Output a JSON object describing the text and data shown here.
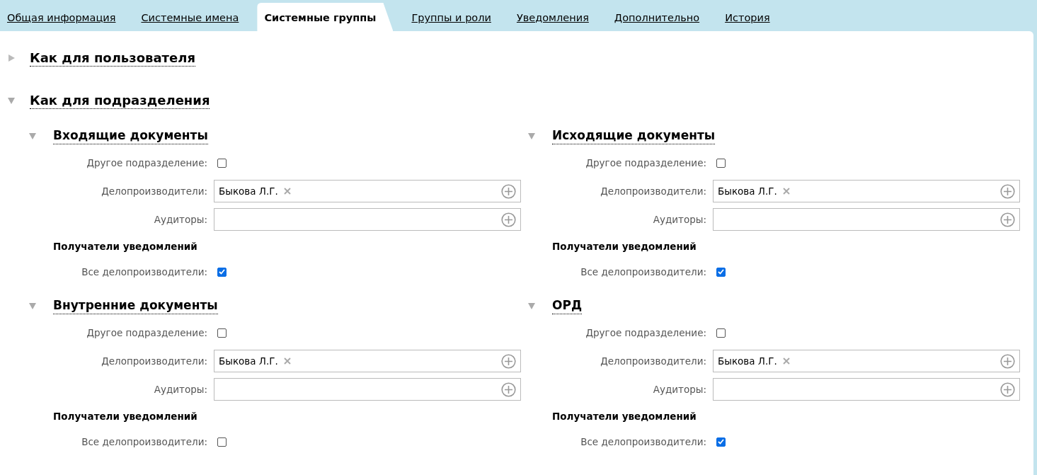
{
  "tabs": [
    {
      "label": "Общая информация",
      "selected": false
    },
    {
      "label": "Системные имена",
      "selected": false
    },
    {
      "label": "Системные группы",
      "selected": true
    },
    {
      "label": "Группы и роли",
      "selected": false
    },
    {
      "label": "Уведомления",
      "selected": false
    },
    {
      "label": "Дополнительно",
      "selected": false
    },
    {
      "label": "История",
      "selected": false
    }
  ],
  "sections": [
    {
      "title": "Как для пользователя",
      "expanded": false
    },
    {
      "title": "Как для подразделения",
      "expanded": true,
      "subsections": [
        {
          "title": "Входящие документы",
          "expanded": true,
          "fields": [
            {
              "kind": "checkbox",
              "label": "Другое подразделение:",
              "checked": false
            },
            {
              "kind": "picker",
              "label": "Делопроизводители:",
              "tags": [
                "Быкова Л.Г."
              ]
            },
            {
              "kind": "picker",
              "label": "Аудиторы:"
            },
            {
              "kind": "heading",
              "label": "Получатели уведомлений"
            },
            {
              "kind": "checkbox",
              "label": "Все делопроизводители:",
              "checked": true
            }
          ]
        },
        {
          "title": "Исходящие документы",
          "expanded": true,
          "fields": [
            {
              "kind": "checkbox",
              "label": "Другое подразделение:",
              "checked": false
            },
            {
              "kind": "picker",
              "label": "Делопроизводители:",
              "tags": [
                "Быкова Л.Г."
              ]
            },
            {
              "kind": "picker",
              "label": "Аудиторы:"
            },
            {
              "kind": "heading",
              "label": "Получатели уведомлений"
            },
            {
              "kind": "checkbox",
              "label": "Все делопроизводители:",
              "checked": true
            }
          ]
        },
        {
          "title": "Внутренние документы",
          "expanded": true,
          "fields": [
            {
              "kind": "checkbox",
              "label": "Другое подразделение:",
              "checked": false
            },
            {
              "kind": "picker",
              "label": "Делопроизводители:",
              "tags": [
                "Быкова Л.Г."
              ]
            },
            {
              "kind": "picker",
              "label": "Аудиторы:"
            },
            {
              "kind": "heading",
              "label": "Получатели уведомлений"
            },
            {
              "kind": "checkbox",
              "label": "Все делопроизводители:",
              "checked": false
            }
          ]
        },
        {
          "title": "ОРД",
          "expanded": true,
          "fields": [
            {
              "kind": "checkbox",
              "label": "Другое подразделение:",
              "checked": false
            },
            {
              "kind": "picker",
              "label": "Делопроизводители:",
              "tags": [
                "Быкова Л.Г."
              ]
            },
            {
              "kind": "picker",
              "label": "Аудиторы:"
            },
            {
              "kind": "heading",
              "label": "Получатели уведомлений"
            },
            {
              "kind": "checkbox",
              "label": "Все делопроизводители:",
              "checked": true
            }
          ]
        }
      ]
    }
  ]
}
